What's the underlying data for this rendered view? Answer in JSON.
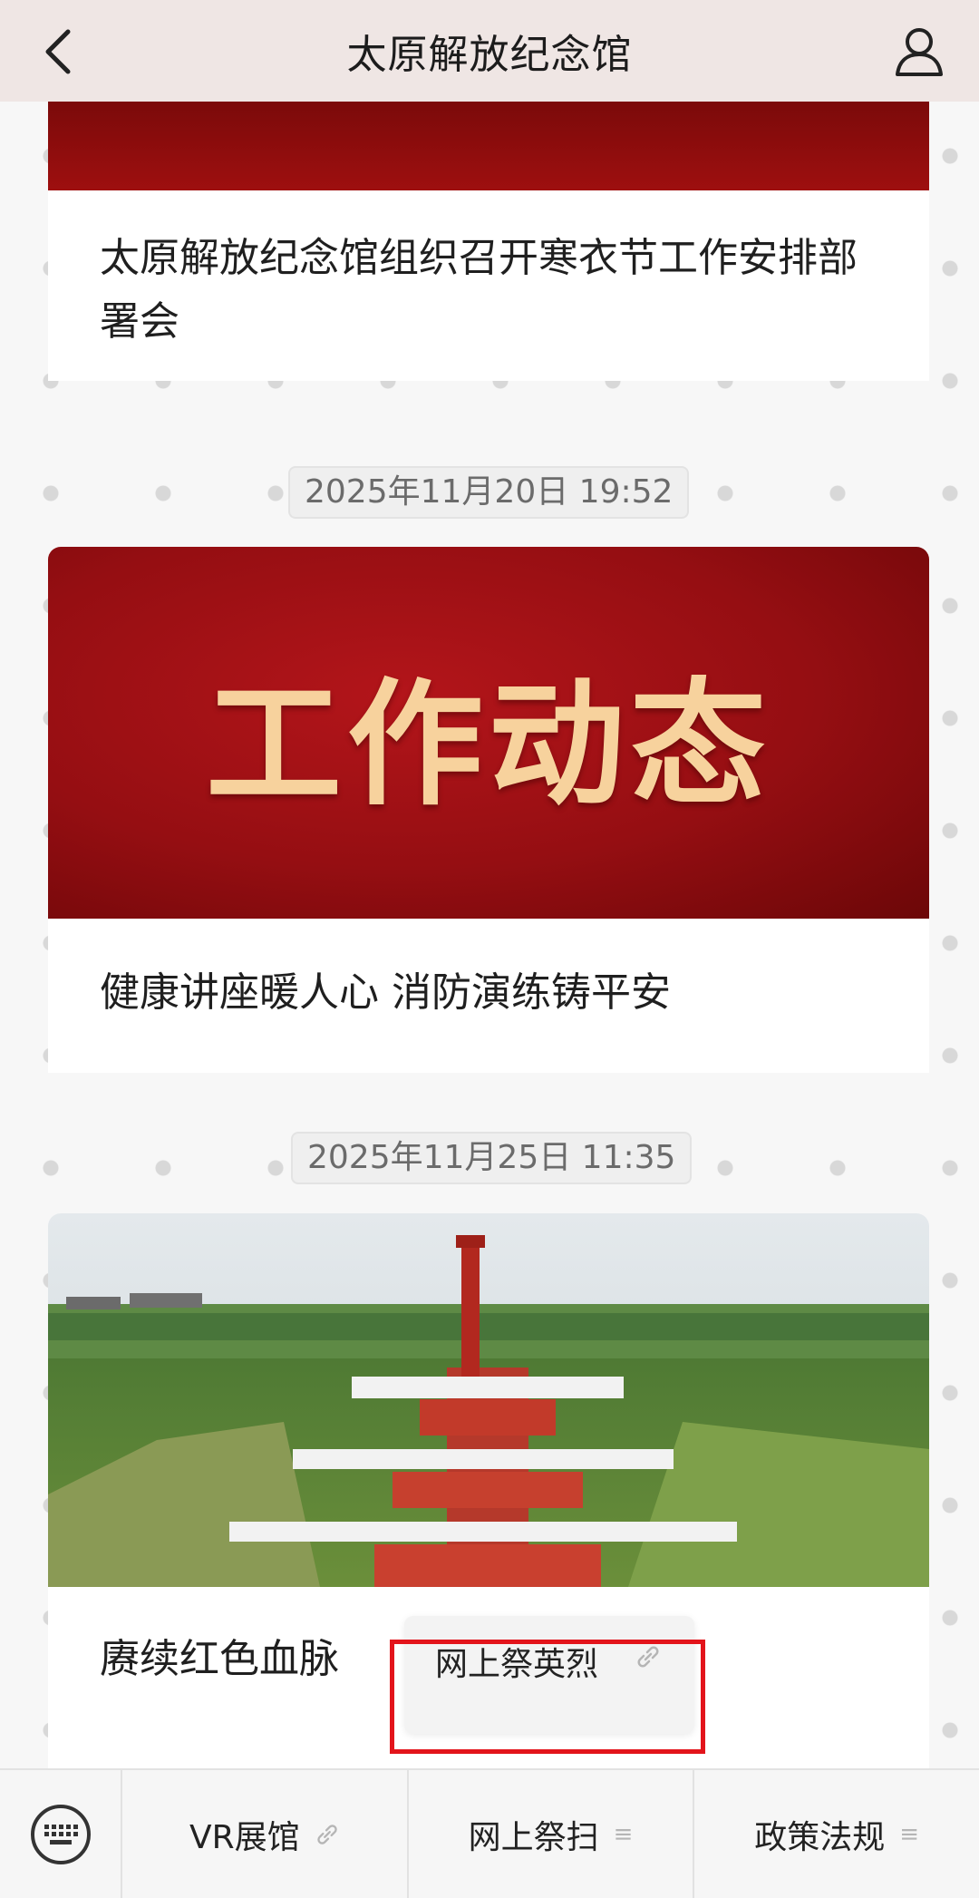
{
  "header": {
    "title": "太原解放纪念馆",
    "back_icon": "chevron-left-icon",
    "user_icon": "user-icon"
  },
  "feed": {
    "items": [
      {
        "title": "太原解放纪念馆组织召开寒衣节工作安排部署会"
      },
      {
        "timestamp": "2025年11月20日 19:52",
        "banner_text": "工作动态",
        "title": "健康讲座暖人心 消防演练铸平安"
      },
      {
        "timestamp": "2025年11月25日 11:35",
        "title": "赓续红色血脉"
      }
    ]
  },
  "popup": {
    "label": "网上祭英烈",
    "icon": "link-icon"
  },
  "bottom_menu": {
    "keyboard_icon": "keyboard-icon",
    "items": [
      {
        "label": "VR展馆",
        "icon": "link-icon"
      },
      {
        "label": "网上祭扫",
        "icon": "menu-icon"
      },
      {
        "label": "政策法规",
        "icon": "menu-icon"
      }
    ]
  },
  "colors": {
    "accent_red": "#9e0f0f",
    "banner_text": "#f7d29d",
    "highlight_border": "#e3141b",
    "header_bg": "#efe6e4"
  }
}
